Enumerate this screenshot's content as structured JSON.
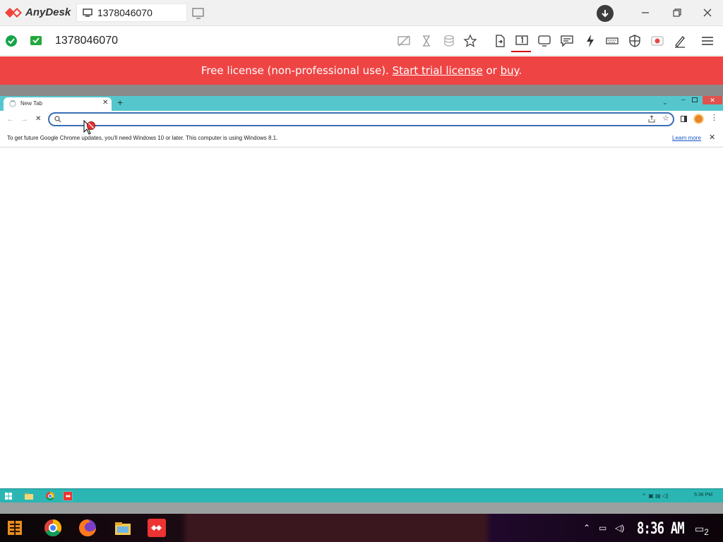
{
  "anydesk": {
    "app_name": "AnyDesk",
    "session_tab_label": "1378046070",
    "address": "1378046070",
    "brand_color": "#ef443b"
  },
  "toolbar": {
    "icons": [
      "privacy-mode-icon",
      "hourglass-icon",
      "stack-icon",
      "star-icon",
      "file-transfer-icon",
      "display-1-icon",
      "monitor-icon",
      "chat-icon",
      "actions-icon",
      "keyboard-icon",
      "permissions-icon",
      "record-icon",
      "whiteboard-icon",
      "menu-icon"
    ]
  },
  "banner": {
    "prefix": "Free license (non-professional use). ",
    "trial_link": "Start trial license",
    "middle": " or ",
    "buy_link": "buy",
    "suffix": ".",
    "color": "#ef4444"
  },
  "chrome": {
    "tab_title": "New Tab",
    "new_tab_symbol": "+",
    "omnibox_value": "",
    "info_message": "To get future Google Chrome updates, you'll need Windows 10 or later. This computer is using Windows 8.1.",
    "learn_more": "Learn more",
    "accent": "#55c7cc"
  },
  "remote_taskbar": {
    "time": "5:36 PM",
    "tray_symbol": "^"
  },
  "local_taskbar": {
    "clock": "8:36 AM",
    "notification_count": "2"
  }
}
